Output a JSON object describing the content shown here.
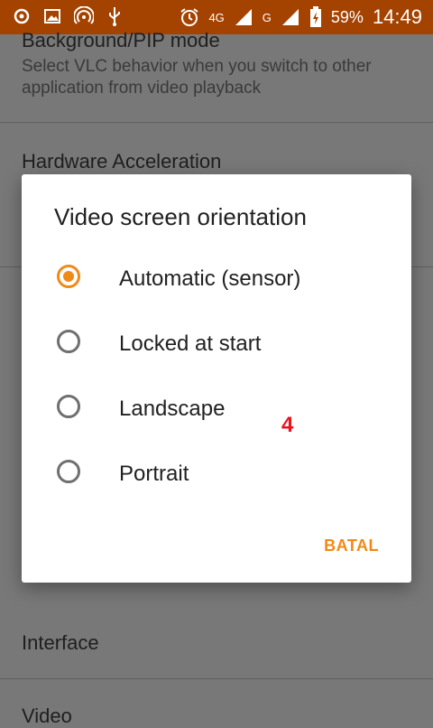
{
  "status_bar": {
    "battery_percent": "59%",
    "time": "14:49",
    "network_a": "4G",
    "network_b": "4G",
    "network_c": "G",
    "icons": [
      "media-icon",
      "image-icon",
      "hotspot-icon",
      "usb-icon",
      "alarm-icon",
      "signal-icon",
      "signal-icon",
      "battery-charging-icon"
    ]
  },
  "settings": {
    "background_pip_title": "Background/PIP mode",
    "background_pip_summary": "Select VLC behavior when you switch to other application from video playback",
    "hw_accel_title": "Hardware Acceleration",
    "interface_title": "Interface",
    "video_title": "Video"
  },
  "dialog": {
    "title": "Video screen orientation",
    "options": [
      {
        "label": "Automatic (sensor)",
        "selected": true
      },
      {
        "label": "Locked at start",
        "selected": false
      },
      {
        "label": "Landscape",
        "selected": false
      },
      {
        "label": "Portrait",
        "selected": false
      }
    ],
    "overlay_number": "4",
    "cancel_label": "BATAL"
  },
  "colors": {
    "status_bar": "#a44200",
    "accent": "#f08a17",
    "overlay_number": "#e8131f"
  }
}
